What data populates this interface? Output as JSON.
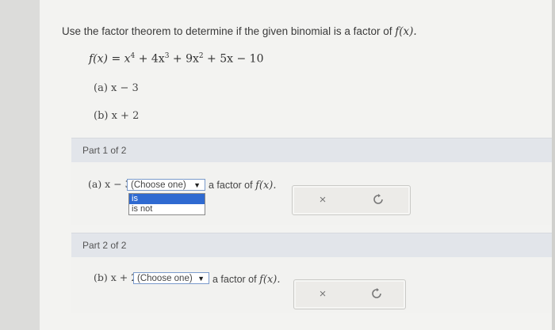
{
  "question": {
    "text": "Use the factor theorem to determine if the given binomial is a factor of ",
    "function_ref": "f(x)."
  },
  "formula": {
    "lhs": "f(x) = x",
    "exp4": "4",
    "t2": " + 4x",
    "exp3": "3",
    "t3": " + 9x",
    "exp2": "2",
    "t4": " + 5x − 10"
  },
  "items": [
    {
      "label": "(a) x − 3"
    },
    {
      "label": "(b) x + 2"
    }
  ],
  "parts": [
    {
      "header": "Part 1 of 2",
      "prefix": "(a) x − 3",
      "select_value": "(Choose one)",
      "suffix_text": "a factor of ",
      "suffix_fn": "f(x).",
      "dropdown_open": true,
      "options": [
        "is",
        "is not"
      ],
      "highlighted_option": "is"
    },
    {
      "header": "Part 2 of 2",
      "prefix": "(b) x + 2",
      "select_value": "(Choose one)",
      "suffix_text": "a factor of ",
      "suffix_fn": "f(x)."
    }
  ],
  "icons": {
    "clear": "×",
    "retry": "retry-icon",
    "dropdown_arrow": "▼"
  },
  "colors": {
    "part_header_bg": "#e2e5ea",
    "select_border": "#7a9acb",
    "option_highlight": "#2f6ad1"
  }
}
